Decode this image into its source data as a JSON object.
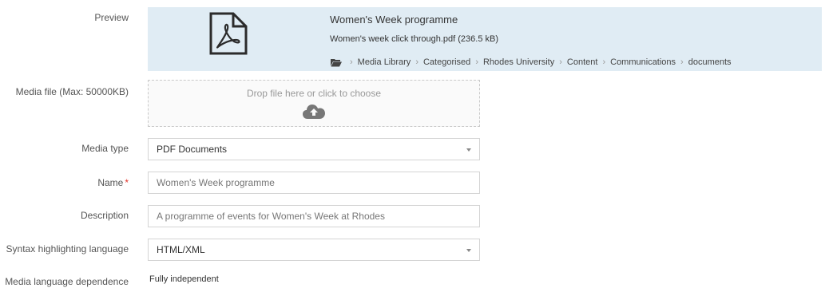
{
  "preview": {
    "label": "Preview",
    "title": "Women's Week programme",
    "file": "Women's week click through.pdf (236.5 kB)",
    "breadcrumb": [
      "Media Library",
      "Categorised",
      "Rhodes University",
      "Content",
      "Communications",
      "documents"
    ],
    "icon": "pdf-file-icon"
  },
  "media_file": {
    "label": "Media file (Max: 50000KB)",
    "dropzone_text": "Drop file here or click to choose",
    "icon": "cloud-upload-icon"
  },
  "media_type": {
    "label": "Media type",
    "value": "PDF Documents"
  },
  "name": {
    "label": "Name",
    "required_marker": "*",
    "value": "Women's Week programme"
  },
  "description": {
    "label": "Description",
    "value": "A programme of events for Women's Week at Rhodes"
  },
  "syntax": {
    "label": "Syntax highlighting language",
    "value": "HTML/XML"
  },
  "language_dependence": {
    "label": "Media language dependence",
    "value": "Fully independent"
  },
  "colors": {
    "preview_bg": "#e0ecf4",
    "required": "#e2342b",
    "label_text": "#555555"
  }
}
